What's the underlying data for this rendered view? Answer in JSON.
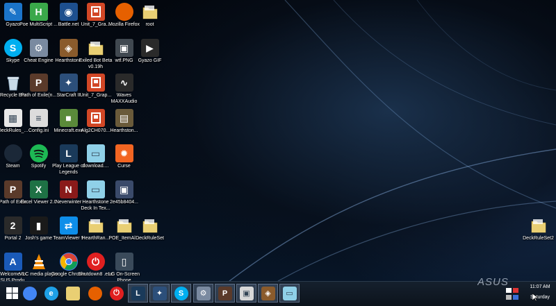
{
  "desktop": {
    "icons": [
      {
        "label": "Gyazo",
        "icon": "gyazo-icon",
        "color": "#1b74c9"
      },
      {
        "label": "Poe MultiScript ...",
        "icon": "poe-multiscript-icon",
        "color": "#3aa84a"
      },
      {
        "label": "Battle.net",
        "icon": "battlenet-icon",
        "color": "#1d4f8e"
      },
      {
        "label": "Unit_7_Gra...",
        "icon": "powerpoint-icon",
        "color": "#d24726"
      },
      {
        "label": "Mozilla Firefox",
        "icon": "firefox-icon",
        "color": "#e66000"
      },
      {
        "label": "root",
        "icon": "folder-icon",
        "color": "#e9cf73"
      },
      {
        "label": "Skype",
        "icon": "skype-icon",
        "color": "#00aff0"
      },
      {
        "label": "Cheat Engine",
        "icon": "cheat-engine-icon",
        "color": "#7a8aa0"
      },
      {
        "label": "Hearthstone",
        "icon": "hearthstone-icon",
        "color": "#8a5b2c"
      },
      {
        "label": "Exiled Bot Beta v0.19h",
        "icon": "folder-icon",
        "color": "#e9cf73"
      },
      {
        "label": "wtf.PNG",
        "icon": "image-file-icon",
        "color": "#404850"
      },
      {
        "label": "Gyazo GIF",
        "icon": "gyazo-gif-icon",
        "color": "#2a2a2a"
      },
      {
        "label": "Recycle Bin",
        "icon": "recycle-bin-icon",
        "color": "#9bb8d0"
      },
      {
        "label": "Path of Exile(n...",
        "icon": "path-of-exile-icon",
        "color": "#5a3a2a"
      },
      {
        "label": "StarCraft II",
        "icon": "starcraft-icon",
        "color": "#2c4f7a"
      },
      {
        "label": "Unit_7_Grap...",
        "icon": "powerpoint-icon",
        "color": "#d24726"
      },
      {
        "label": "Waves MAXXAudio",
        "icon": "waves-audio-icon",
        "color": "#2a2a2a"
      },
      {
        "label": "DeckRules_...",
        "icon": "spreadsheet-icon",
        "color": "#e8e8e8"
      },
      {
        "label": "Config.ini",
        "icon": "config-file-icon",
        "color": "#dcdcdc"
      },
      {
        "label": "Minecraft.exe",
        "icon": "minecraft-icon",
        "color": "#5a8a3a"
      },
      {
        "label": "Alg2CH070...",
        "icon": "powerpoint-icon",
        "color": "#d24726"
      },
      {
        "label": "Hearthston...",
        "icon": "hearthstone-deck-icon",
        "color": "#6a5a3a"
      },
      {
        "label": "Steam",
        "icon": "steam-icon",
        "color": "#1b2838"
      },
      {
        "label": "Spotify",
        "icon": "spotify-icon",
        "color": "#1db954"
      },
      {
        "label": "Play League of Legends",
        "icon": "league-icon",
        "color": "#1a3a5a"
      },
      {
        "label": "download....",
        "icon": "document-icon",
        "color": "#8fd0e8"
      },
      {
        "label": "Curse",
        "icon": "curse-icon",
        "color": "#f26522"
      },
      {
        "label": "Path of Exile",
        "icon": "path-of-exile-icon",
        "color": "#5a3a2a"
      },
      {
        "label": "Excel Viewer 2.0",
        "icon": "excel-viewer-icon",
        "color": "#1e7145"
      },
      {
        "label": "Neverwinter",
        "icon": "neverwinter-icon",
        "color": "#8a1a1a"
      },
      {
        "label": "Hearthstone Deck In Tex...",
        "icon": "document-icon",
        "color": "#8fd0e8"
      },
      {
        "label": "2e45b8404...",
        "icon": "image-file-icon",
        "color": "#3a4a6a"
      },
      {
        "label": "Portal 2",
        "icon": "portal-icon",
        "color": "#2a2a2a"
      },
      {
        "label": "Josh's game",
        "icon": "game-file-icon",
        "color": "#1a1a1a"
      },
      {
        "label": "TeamViewer 9",
        "icon": "teamviewer-icon",
        "color": "#0e8ee9"
      },
      {
        "label": "HearthRan...",
        "icon": "folder-icon",
        "color": "#e9cf73"
      },
      {
        "label": "POE_ItemAl...",
        "icon": "folder-icon",
        "color": "#e9cf73"
      },
      {
        "label": "DeckRuleSet",
        "icon": "folder-icon",
        "color": "#e9cf73"
      },
      {
        "label": "Welcome to ASUS Produ...",
        "icon": "asus-icon",
        "color": "#1a5ab8"
      },
      {
        "label": "VLC media player",
        "icon": "vlc-icon",
        "color": "#f08a00"
      },
      {
        "label": "Google Chrome",
        "icon": "chrome-icon",
        "color": "#4285f4"
      },
      {
        "label": "Shutdown8 .exe",
        "icon": "shutdown-icon",
        "color": "#e02020"
      },
      {
        "label": "LG On-Screen Phone",
        "icon": "lg-phone-icon",
        "color": "#3a4a5a"
      },
      {
        "label": "DeckRuleSet2",
        "icon": "folder-icon",
        "color": "#e9cf73"
      }
    ]
  },
  "taskbar": {
    "start_label": "Start",
    "pinned": [
      {
        "icon": "chrome-icon",
        "color": "#4285f4"
      },
      {
        "icon": "internet-explorer-icon",
        "color": "#1ea0e6"
      },
      {
        "icon": "file-explorer-icon",
        "color": "#e9cf73"
      },
      {
        "icon": "firefox-icon",
        "color": "#e66000"
      },
      {
        "icon": "shutdown-icon",
        "color": "#e02020"
      },
      {
        "icon": "league-icon",
        "color": "#1a3a5a"
      },
      {
        "icon": "starcraft-icon",
        "color": "#2c4f7a"
      },
      {
        "icon": "skype-icon",
        "color": "#00aff0"
      },
      {
        "icon": "cheat-engine-icon",
        "color": "#7a8aa0"
      },
      {
        "icon": "path-of-exile-icon",
        "color": "#5a3a2a"
      },
      {
        "icon": "image-viewer-icon",
        "color": "#d8d8d8"
      },
      {
        "icon": "hearthstone-icon",
        "color": "#8a5b2c"
      },
      {
        "icon": "document-icon",
        "color": "#8fd0e8"
      }
    ],
    "clock_time": "11:07 AM",
    "clock_day": "Saturday"
  },
  "brand": {
    "logo_text": "ASUS"
  }
}
